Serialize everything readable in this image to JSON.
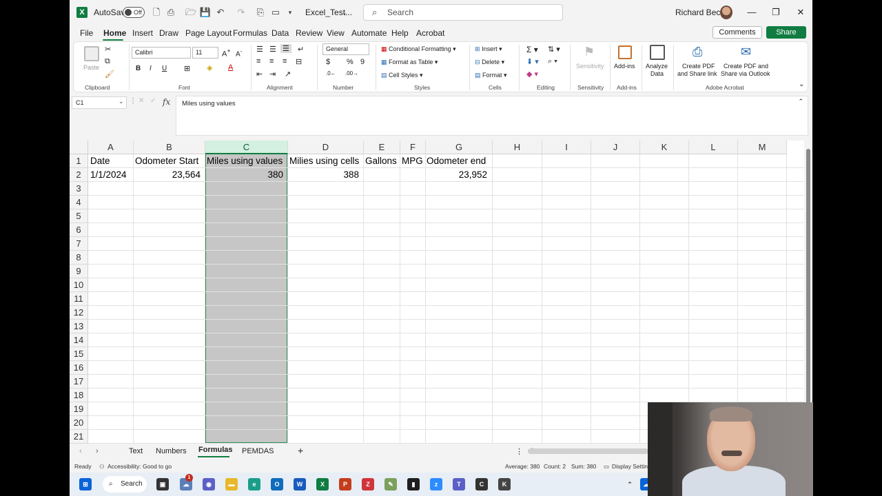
{
  "titlebar": {
    "autosave_label": "AutoSave",
    "autosave_state": "Off",
    "filename": "Excel_Test...",
    "search_placeholder": "Search",
    "user_name": "Richard Becker"
  },
  "menu": {
    "tabs": [
      "File",
      "Home",
      "Insert",
      "Draw",
      "Page Layout",
      "Formulas",
      "Data",
      "Review",
      "View",
      "Automate",
      "Help",
      "Acrobat"
    ],
    "active_tab": "Home",
    "comments_label": "Comments",
    "share_label": "Share"
  },
  "ribbon": {
    "clipboard": {
      "paste": "Paste",
      "label": "Clipboard"
    },
    "font": {
      "name": "Calibri",
      "size": "11",
      "label": "Font"
    },
    "alignment": {
      "label": "Alignment"
    },
    "number": {
      "format": "General",
      "label": "Number"
    },
    "styles": {
      "conditional": "Conditional Formatting",
      "format_table": "Format as Table",
      "cell_styles": "Cell Styles",
      "label": "Styles"
    },
    "cells": {
      "insert": "Insert",
      "delete": "Delete",
      "format": "Format",
      "label": "Cells"
    },
    "editing": {
      "label": "Editing"
    },
    "sensitivity": {
      "button": "Sensitivity",
      "label": "Sensitivity"
    },
    "addins": {
      "button": "Add-ins",
      "label": "Add-ins"
    },
    "analyze": {
      "line1": "Analyze",
      "line2": "Data"
    },
    "acrobat": {
      "create_share_1": "Create PDF",
      "create_share_2": "and Share link",
      "create_outlook_1": "Create PDF and",
      "create_outlook_2": "Share via Outlook",
      "label": "Adobe Acrobat"
    }
  },
  "formula_bar": {
    "name_box": "C1",
    "fx": "fx",
    "content": "Miles using values"
  },
  "sheet": {
    "columns": [
      "A",
      "B",
      "C",
      "D",
      "E",
      "F",
      "G",
      "H",
      "I",
      "J",
      "K",
      "L",
      "M"
    ],
    "rows": [
      "1",
      "2",
      "3",
      "4",
      "5",
      "6",
      "7",
      "8",
      "9",
      "10",
      "11",
      "12",
      "13",
      "14",
      "15",
      "16",
      "17",
      "18",
      "19",
      "20",
      "21"
    ],
    "selected_column": "C",
    "row1": [
      "Date",
      "Odometer Start",
      "Miles using values",
      "Milies using cells",
      "Gallons",
      "MPG",
      "Odometer end"
    ],
    "row2": [
      "1/1/2024",
      "23,564",
      "380",
      "388",
      "",
      "",
      "23,952"
    ]
  },
  "sheet_tabs": [
    "Text",
    "Numbers",
    "Formulas",
    "PEMDAS"
  ],
  "active_sheet": "Formulas",
  "status": {
    "ready": "Ready",
    "accessibility": "Accessibility: Good to go",
    "average": "Average: 380",
    "count": "Count: 2",
    "sum": "Sum: 380",
    "display": "Display Settings"
  },
  "taskbar": {
    "search": "Search",
    "notification_badge": "1"
  },
  "colors": {
    "excel_green": "#107c41",
    "selection_fill": "#c6c6c6",
    "selection_border": "#2e8b57"
  }
}
